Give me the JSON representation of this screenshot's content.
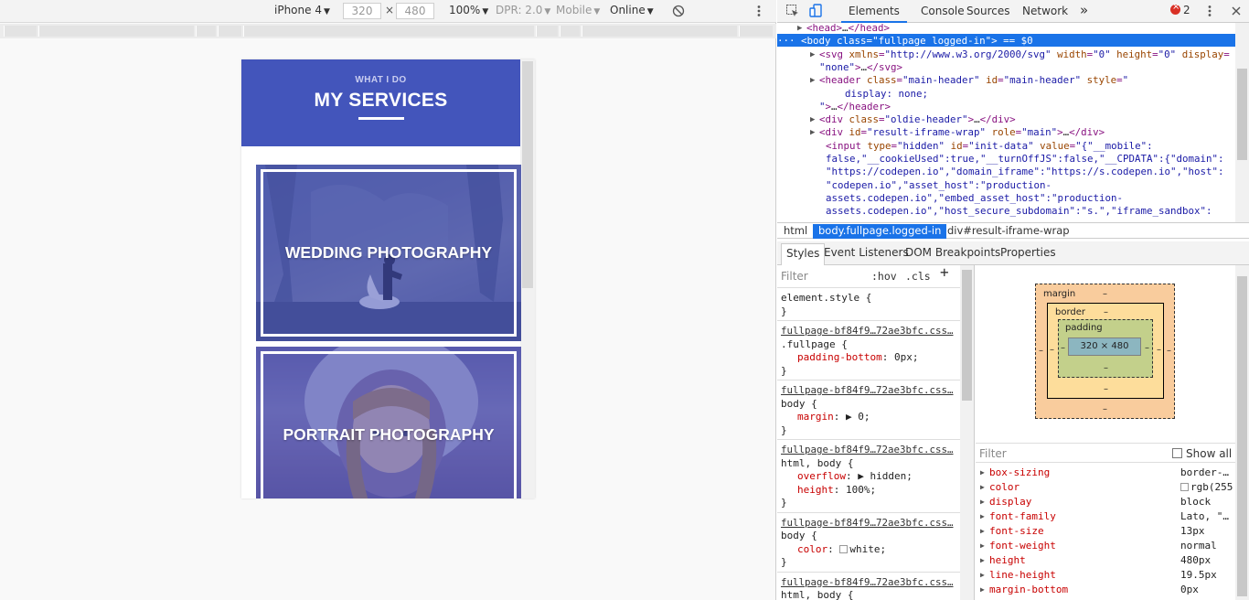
{
  "device_toolbar": {
    "device": "iPhone 4",
    "width": "320",
    "height": "480",
    "times": "×",
    "zoom": "100%",
    "dpr": "DPR: 2.0",
    "mode": "Mobile",
    "network": "Online"
  },
  "preview": {
    "kicker": "WHAT I DO",
    "title": "MY SERVICES",
    "cards": [
      {
        "title": "WEDDING PHOTOGRAPHY"
      },
      {
        "title": "PORTRAIT PHOTOGRAPHY"
      }
    ],
    "accent": "#4355bb"
  },
  "devtools": {
    "tabs": [
      "Elements",
      "Console",
      "Sources",
      "Network"
    ],
    "more_tabs": "»",
    "error_count": "2",
    "dom_lines": [
      {
        "indent": 2,
        "tri": "▶",
        "parts": [
          [
            "tag",
            "<head>"
          ],
          [
            "txt",
            "…"
          ],
          [
            "tag",
            "</head>"
          ]
        ]
      },
      {
        "indent": 0,
        "tri": "▼",
        "selected": true,
        "parts": [
          [
            "txt",
            "··· "
          ],
          [
            "tag",
            "<body "
          ],
          [
            "attr",
            "class"
          ],
          [
            "tag",
            "="
          ],
          [
            "val",
            "\"fullpage logged-in\""
          ],
          [
            "tag",
            "> "
          ],
          [
            "txt",
            "== $0"
          ]
        ]
      },
      {
        "indent": 4,
        "tri": "▶",
        "parts": [
          [
            "tag",
            "<svg "
          ],
          [
            "attr",
            "xmlns"
          ],
          [
            "tag",
            "="
          ],
          [
            "val",
            "\"http://www.w3.org/2000/svg\""
          ],
          [
            "tag",
            " "
          ],
          [
            "attr",
            "width"
          ],
          [
            "tag",
            "="
          ],
          [
            "val",
            "\"0\""
          ],
          [
            "tag",
            " "
          ],
          [
            "attr",
            "height"
          ],
          [
            "tag",
            "="
          ],
          [
            "val",
            "\"0\""
          ],
          [
            "tag",
            " "
          ],
          [
            "attr",
            "display"
          ],
          [
            "tag",
            "="
          ]
        ]
      },
      {
        "indent": 4,
        "tri": "",
        "parts": [
          [
            "val",
            "\"none\""
          ],
          [
            "tag",
            ">"
          ],
          [
            "txt",
            "…"
          ],
          [
            "tag",
            "</svg>"
          ]
        ]
      },
      {
        "indent": 4,
        "tri": "▶",
        "parts": [
          [
            "tag",
            "<header "
          ],
          [
            "attr",
            "class"
          ],
          [
            "tag",
            "="
          ],
          [
            "val",
            "\"main-header\""
          ],
          [
            "tag",
            " "
          ],
          [
            "attr",
            "id"
          ],
          [
            "tag",
            "="
          ],
          [
            "val",
            "\"main-header\""
          ],
          [
            "tag",
            " "
          ],
          [
            "attr",
            "style"
          ],
          [
            "tag",
            "="
          ],
          [
            "val",
            "\""
          ]
        ]
      },
      {
        "indent": 8,
        "tri": "",
        "parts": [
          [
            "val",
            "display: none;"
          ]
        ]
      },
      {
        "indent": 4,
        "tri": "",
        "parts": [
          [
            "val",
            "\""
          ],
          [
            "tag",
            ">"
          ],
          [
            "txt",
            "…"
          ],
          [
            "tag",
            "</header>"
          ]
        ]
      },
      {
        "indent": 4,
        "tri": "▶",
        "parts": [
          [
            "tag",
            "<div "
          ],
          [
            "attr",
            "class"
          ],
          [
            "tag",
            "="
          ],
          [
            "val",
            "\"oldie-header\""
          ],
          [
            "tag",
            ">"
          ],
          [
            "txt",
            "…"
          ],
          [
            "tag",
            "</div>"
          ]
        ]
      },
      {
        "indent": 4,
        "tri": "▶",
        "parts": [
          [
            "tag",
            "<div "
          ],
          [
            "attr",
            "id"
          ],
          [
            "tag",
            "="
          ],
          [
            "val",
            "\"result-iframe-wrap\""
          ],
          [
            "tag",
            " "
          ],
          [
            "attr",
            "role"
          ],
          [
            "tag",
            "="
          ],
          [
            "val",
            "\"main\""
          ],
          [
            "tag",
            ">"
          ],
          [
            "txt",
            "…"
          ],
          [
            "tag",
            "</div>"
          ]
        ]
      },
      {
        "indent": 5,
        "tri": "",
        "parts": [
          [
            "tag",
            "<input "
          ],
          [
            "attr",
            "type"
          ],
          [
            "tag",
            "="
          ],
          [
            "val",
            "\"hidden\""
          ],
          [
            "tag",
            " "
          ],
          [
            "attr",
            "id"
          ],
          [
            "tag",
            "="
          ],
          [
            "val",
            "\"init-data\""
          ],
          [
            "tag",
            " "
          ],
          [
            "attr",
            "value"
          ],
          [
            "tag",
            "="
          ],
          [
            "val",
            "\"{\"__mobile\":"
          ]
        ]
      },
      {
        "indent": 5,
        "tri": "",
        "parts": [
          [
            "val",
            "false,\"__cookieUsed\":true,\"__turnOffJS\":false,\"__CPDATA\":{\"domain\":"
          ]
        ]
      },
      {
        "indent": 5,
        "tri": "",
        "parts": [
          [
            "val",
            "\"https://codepen.io\",\"domain_iframe\":\"https://s.codepen.io\",\"host\":"
          ]
        ]
      },
      {
        "indent": 5,
        "tri": "",
        "parts": [
          [
            "val",
            "\"codepen.io\",\"asset_host\":\"production-"
          ]
        ]
      },
      {
        "indent": 5,
        "tri": "",
        "parts": [
          [
            "val",
            "assets.codepen.io\",\"embed_asset_host\":\"production-"
          ]
        ]
      },
      {
        "indent": 5,
        "tri": "",
        "parts": [
          [
            "val",
            "assets.codepen.io\",\"host_secure_subdomain\":\"s.\",\"iframe_sandbox\":"
          ]
        ]
      }
    ],
    "breadcrumbs": [
      "html",
      "body.fullpage.logged-in",
      "div#result-iframe-wrap"
    ],
    "sub_tabs": [
      "Styles",
      "Event Listeners",
      "DOM Breakpoints",
      "Properties"
    ],
    "styles": {
      "filter_placeholder": "Filter",
      "hov": ":hov",
      "cls": ".cls",
      "add": "+",
      "rules": [
        {
          "src": "",
          "selector": "element.style {",
          "props": []
        },
        {
          "src": "fullpage-bf84f9…72ae3bfc.css…",
          "selector": ".fullpage {",
          "props": [
            [
              "padding-bottom",
              "0px;"
            ]
          ]
        },
        {
          "src": "fullpage-bf84f9…72ae3bfc.css…",
          "selector": "body {",
          "props": [
            [
              "margin",
              "▶ 0;"
            ]
          ]
        },
        {
          "src": "fullpage-bf84f9…72ae3bfc.css…",
          "selector": "html, body {",
          "props": [
            [
              "overflow",
              "▶ hidden;"
            ],
            [
              "height",
              "100%;"
            ]
          ]
        },
        {
          "src": "fullpage-bf84f9…72ae3bfc.css…",
          "selector": "body {",
          "props": [
            [
              "color",
              "white;"
            ]
          ]
        },
        {
          "src": "fullpage-bf84f9…72ae3bfc.css…",
          "selector": "html, body {",
          "props": []
        }
      ]
    },
    "box_model": {
      "margin_label": "margin",
      "border_label": "border",
      "padding_label": "padding",
      "content": "320 × 480",
      "dash": "–"
    },
    "computed": {
      "filter_placeholder": "Filter",
      "show_all": "Show all",
      "rows": [
        [
          "box-sizing",
          "border-…"
        ],
        [
          "color",
          "rgb(255"
        ],
        [
          "display",
          "block"
        ],
        [
          "font-family",
          "Lato, \"…"
        ],
        [
          "font-size",
          "13px"
        ],
        [
          "font-weight",
          "normal"
        ],
        [
          "height",
          "480px"
        ],
        [
          "line-height",
          "19.5px"
        ],
        [
          "margin-bottom",
          "0px"
        ]
      ]
    }
  }
}
